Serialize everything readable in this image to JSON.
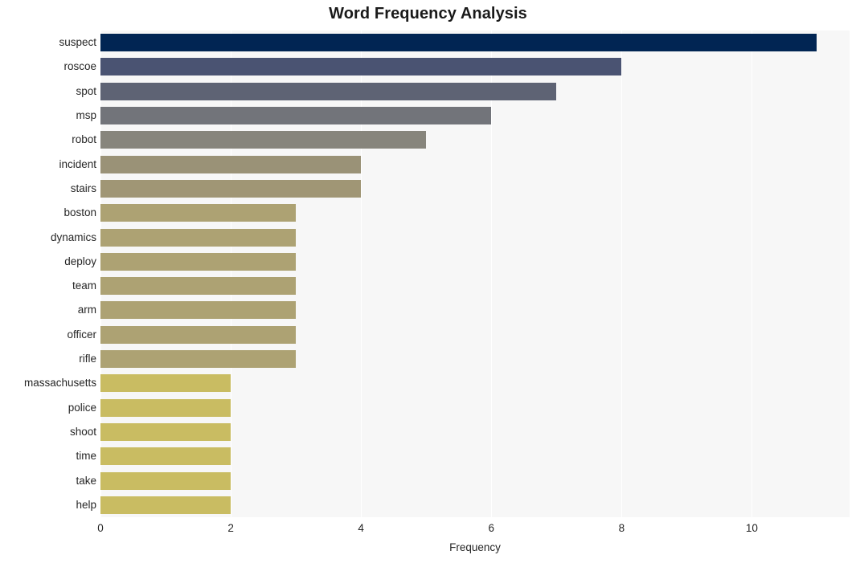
{
  "chart_data": {
    "type": "bar",
    "orientation": "horizontal",
    "title": "Word Frequency Analysis",
    "xlabel": "Frequency",
    "ylabel": "",
    "categories": [
      "suspect",
      "roscoe",
      "spot",
      "msp",
      "robot",
      "incident",
      "stairs",
      "boston",
      "dynamics",
      "deploy",
      "team",
      "arm",
      "officer",
      "rifle",
      "massachusetts",
      "police",
      "shoot",
      "time",
      "take",
      "help"
    ],
    "values": [
      11,
      8,
      7,
      6,
      5,
      4,
      4,
      3,
      3,
      3,
      3,
      3,
      3,
      3,
      2,
      2,
      2,
      2,
      2,
      2
    ],
    "bar_colors": [
      "#012553",
      "#4a5372",
      "#5e6374",
      "#72747a",
      "#87857c",
      "#9a9277",
      "#a09675",
      "#ada273",
      "#ada273",
      "#ada273",
      "#ada273",
      "#ada273",
      "#ada273",
      "#ada273",
      "#c9bc62",
      "#c9bc62",
      "#c9bc62",
      "#c9bc62",
      "#c9bc62",
      "#c9bc62"
    ],
    "xticks": [
      0,
      2,
      4,
      6,
      8,
      10
    ],
    "xtick_labels": [
      "0",
      "2",
      "4",
      "6",
      "8",
      "10"
    ],
    "xlim": [
      0,
      11.5
    ],
    "grid": true,
    "grid_axis": "x",
    "legend": null,
    "plot_background": "#f7f7f7",
    "figure_background": "#ffffff"
  }
}
